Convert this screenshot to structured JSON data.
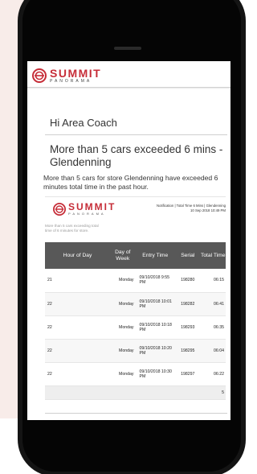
{
  "brand": {
    "name": "SUMMIT",
    "sub": "PANORAMA",
    "color": "#c62d38"
  },
  "email": {
    "greeting": "Hi Area Coach",
    "title": "More than 5 cars exceeded 6 mins - Glendenning",
    "description": "More than 5 cars for store Glendenning have exceeded 6 minutes total time in the past hour."
  },
  "report": {
    "meta_line1": "Notification | Total Time 6 Mins | Glendenning",
    "meta_line2": "10 Sep 2018 10:49 PM",
    "intro": "More than 5 cars exceeding total time of 6 minutes for store.",
    "columns": [
      "Hour of Day",
      "Day of Week",
      "Entry Time",
      "Serial",
      "Total Time"
    ],
    "rows": [
      {
        "hour": "21",
        "day": "Monday",
        "entry": "09/10/2018 9:55 PM",
        "serial": "198280",
        "total": "06:15"
      },
      {
        "hour": "22",
        "day": "Monday",
        "entry": "09/10/2018 10:01 PM",
        "serial": "198282",
        "total": "06:41"
      },
      {
        "hour": "22",
        "day": "Monday",
        "entry": "09/10/2018 10:18 PM",
        "serial": "198293",
        "total": "06:35"
      },
      {
        "hour": "22",
        "day": "Monday",
        "entry": "09/10/2018 10:20 PM",
        "serial": "198295",
        "total": "06:04"
      },
      {
        "hour": "22",
        "day": "Monday",
        "entry": "09/10/2018 10:30 PM",
        "serial": "198297",
        "total": "06:22"
      }
    ],
    "summary_total": "5"
  }
}
